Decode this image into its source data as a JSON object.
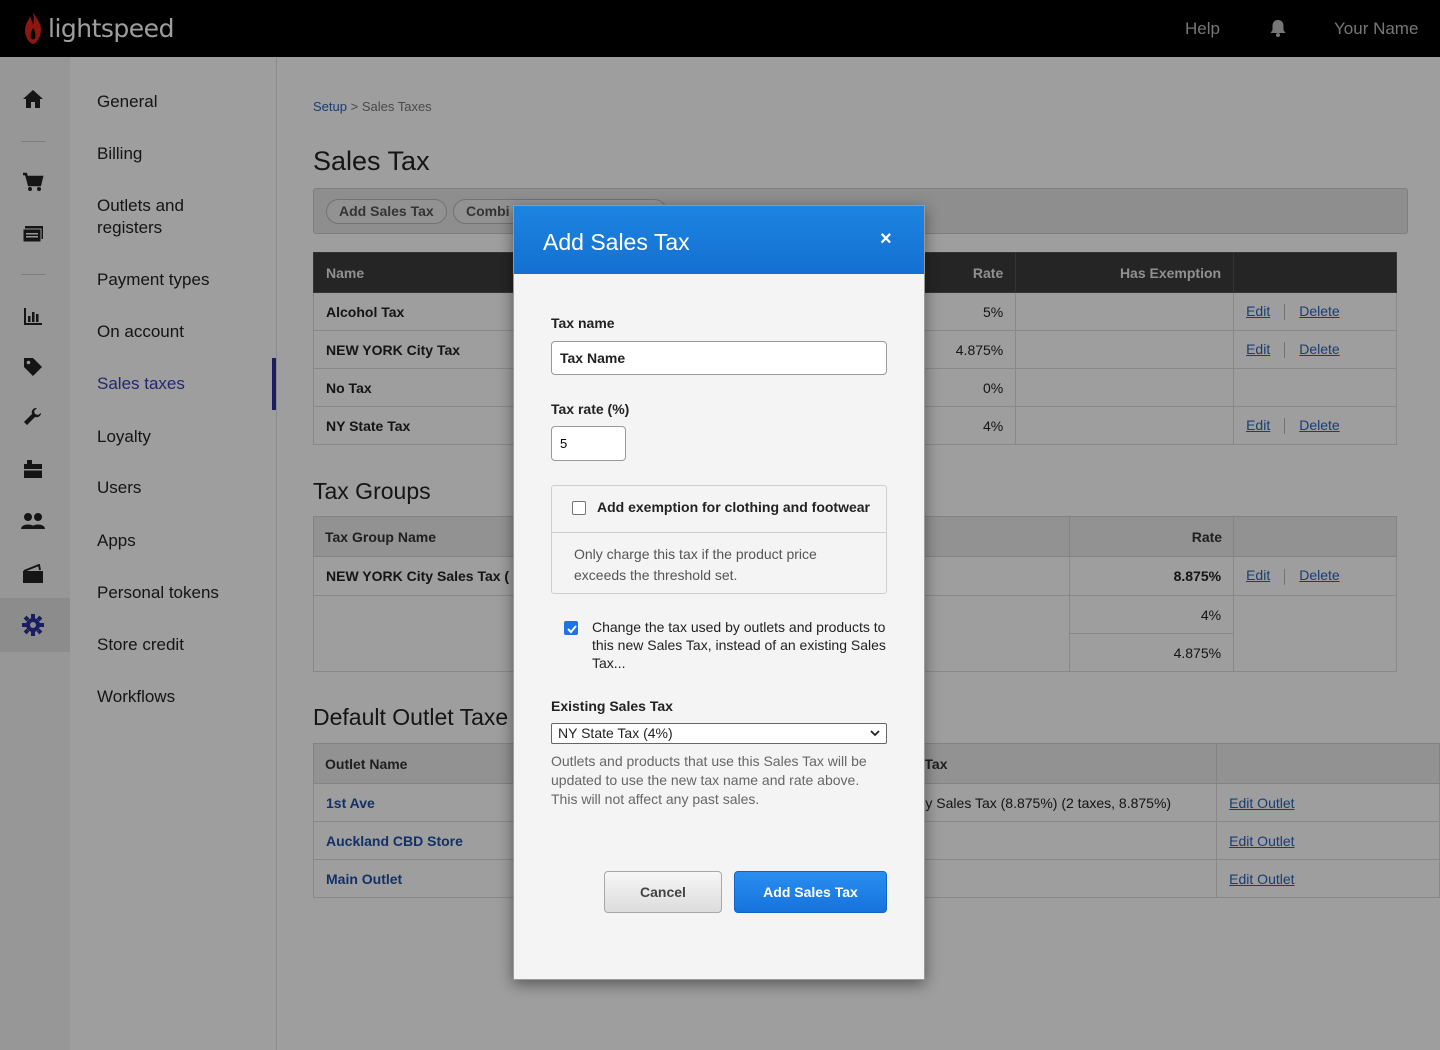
{
  "topbar": {
    "brand": "lightspeed",
    "help": "Help",
    "user": "Your Name"
  },
  "rail": {
    "icons": [
      "home-icon",
      "cart-icon",
      "register-icon",
      "reports-icon",
      "tag-icon",
      "wrench-icon",
      "inventory-icon",
      "customers-icon",
      "cash-icon",
      "gear-icon"
    ],
    "active": "gear-icon"
  },
  "menu": {
    "items": [
      "General",
      "Billing",
      "Outlets and registers",
      "Payment types",
      "On account",
      "Sales taxes",
      "Loyalty",
      "Users",
      "Apps",
      "Personal tokens",
      "Store credit",
      "Workflows"
    ],
    "active_index": 5
  },
  "breadcrumb": {
    "setup": "Setup",
    "current": "> Sales Taxes"
  },
  "page_title": "Sales Tax",
  "toolbar": {
    "add_sales_tax": "Add Sales Tax",
    "combine": "Combi"
  },
  "sales_tax_table": {
    "headers": {
      "name": "Name",
      "rate": "Rate",
      "has_exemption": "Has Exemption"
    },
    "rows": [
      {
        "name": "Alcohol Tax",
        "rate": "5%",
        "edit": "Edit",
        "delete": "Delete"
      },
      {
        "name": "NEW YORK City Tax",
        "rate": "4.875%",
        "edit": "Edit",
        "delete": "Delete"
      },
      {
        "name": "No Tax",
        "rate": "0%",
        "edit": "",
        "delete": ""
      },
      {
        "name": "NY State Tax",
        "rate": "4%",
        "edit": "Edit",
        "delete": "Delete"
      }
    ]
  },
  "tax_groups": {
    "title": "Tax Groups",
    "headers": {
      "name": "Tax Group Name",
      "rate": "Rate"
    },
    "rows": [
      {
        "name": "NEW YORK City Sales Tax (",
        "rate": "8.875%",
        "edit": "Edit",
        "delete": "Delete"
      },
      {
        "name": "",
        "rate": "4%"
      },
      {
        "name": "",
        "rate": "4.875%"
      }
    ]
  },
  "default_outlet": {
    "title": "Default Outlet Taxe",
    "headers": {
      "outlet": "Outlet Name",
      "tax": "Tax"
    },
    "rows": [
      {
        "outlet": "1st Ave",
        "tax": "y Sales Tax (8.875%) (2 taxes, 8.875%)",
        "action": "Edit Outlet"
      },
      {
        "outlet": "Auckland CBD Store",
        "tax": "",
        "action": "Edit Outlet"
      },
      {
        "outlet": "Main Outlet",
        "tax": "",
        "action": "Edit Outlet"
      }
    ]
  },
  "modal": {
    "title": "Add Sales Tax",
    "close": "×",
    "tax_name_label": "Tax name",
    "tax_name_value": "Tax Name",
    "tax_rate_label": "Tax rate (%)",
    "tax_rate_value": "5",
    "exemption_label": "Add exemption for clothing and footwear",
    "exemption_checked": false,
    "exemption_desc": "Only charge this tax if the product price exceeds the threshold set.",
    "change_label": "Change the tax used by outlets and products to this new Sales Tax, instead of an existing Sales Tax...",
    "change_checked": true,
    "existing_label": "Existing Sales Tax",
    "existing_value": "NY State Tax (4%)",
    "existing_help": "Outlets and products that use this Sales Tax will be updated to use the new tax name and rate above. This will not affect any past sales.",
    "cancel": "Cancel",
    "submit": "Add Sales Tax"
  },
  "colors": {
    "brand_red": "#e4261e",
    "accent_blue": "#1a73e8",
    "active_menu": "#3b3fae"
  }
}
